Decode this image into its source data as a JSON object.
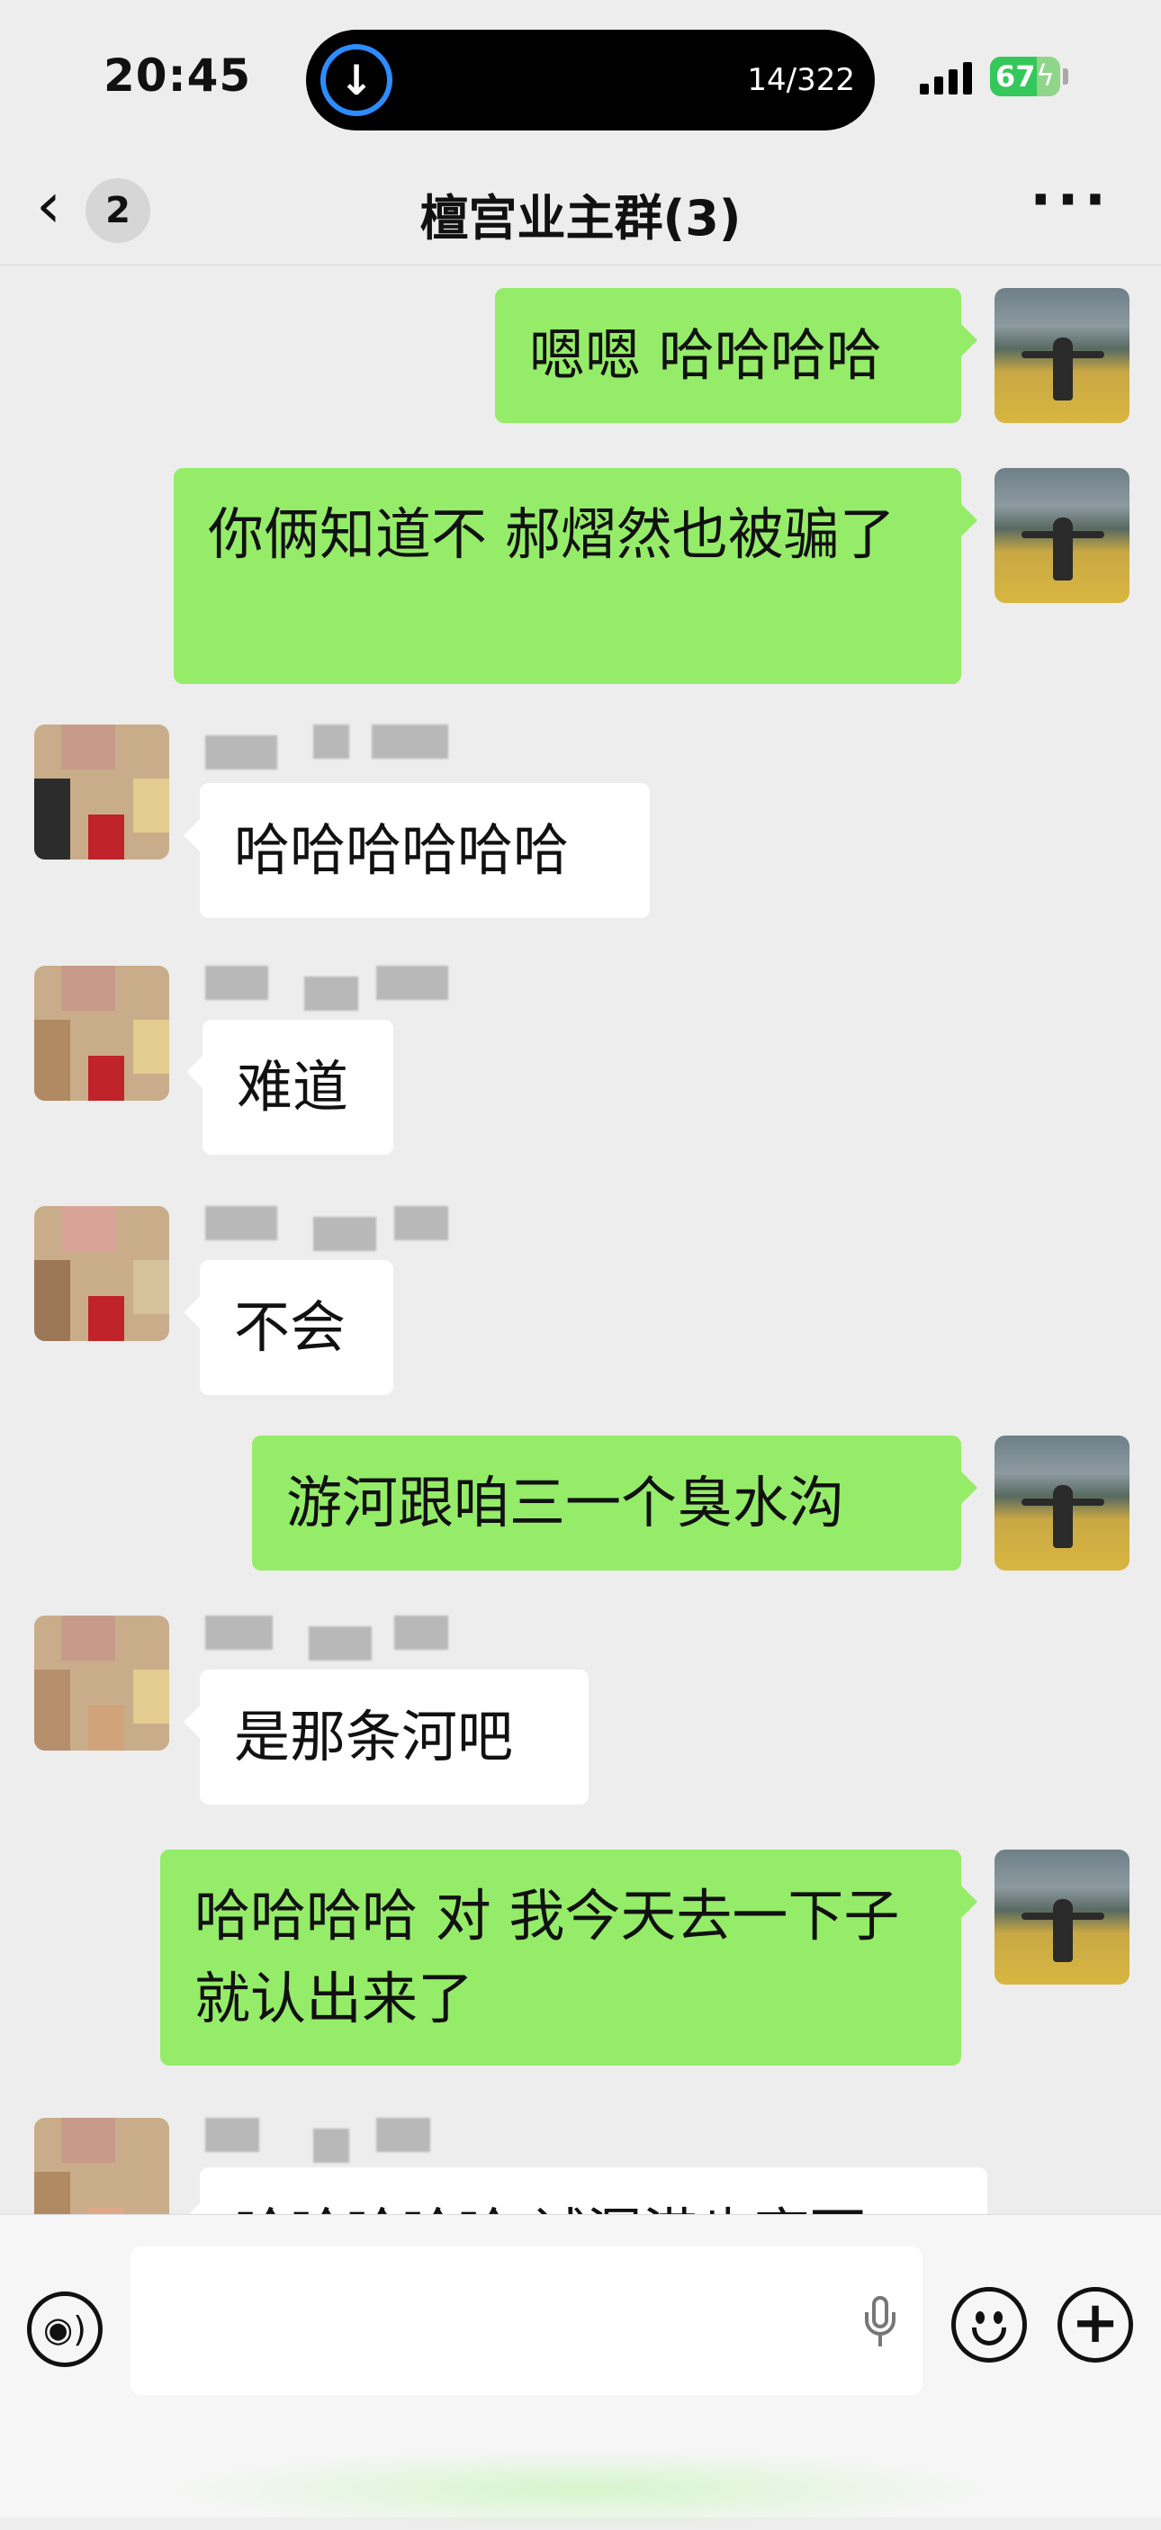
{
  "status_bar": {
    "time": "20:45",
    "download_progress": "14/322",
    "battery": "67",
    "icons": [
      "download-icon",
      "signal-icon",
      "battery-charging-icon"
    ]
  },
  "navbar": {
    "back_icon": "chevron-left-icon",
    "unread_count": "2",
    "title": "檀宫业主群(3)",
    "more_icon": "more-horizontal-icon"
  },
  "messages": [
    {
      "sender": "self",
      "text": "嗯嗯 哈哈哈哈"
    },
    {
      "sender": "self",
      "text": "你俩知道不 郝熠然也被骗了"
    },
    {
      "sender": "other",
      "text": "哈哈哈哈哈哈"
    },
    {
      "sender": "other",
      "text": "难道"
    },
    {
      "sender": "other",
      "text": "不会"
    },
    {
      "sender": "self",
      "text": "游河跟咱三一个臭水沟"
    },
    {
      "sender": "other",
      "text": "是那条河吧"
    },
    {
      "sender": "self",
      "text": "哈哈哈哈 对 我今天去一下子就认出来了"
    },
    {
      "sender": "other",
      "text": "哈哈哈哈哈 试漏港也育丽"
    }
  ],
  "input_bar": {
    "voice_icon": "voice-mode-icon",
    "mic_icon": "microphone-icon",
    "emoji_icon": "emoji-icon",
    "plus_icon": "plus-icon",
    "draft": ""
  },
  "colors": {
    "chat_background": "#ededed",
    "self_bubble": "#95ec69",
    "other_bubble": "#ffffff",
    "battery_green": "#34c759",
    "download_blue": "#2d8cff"
  }
}
